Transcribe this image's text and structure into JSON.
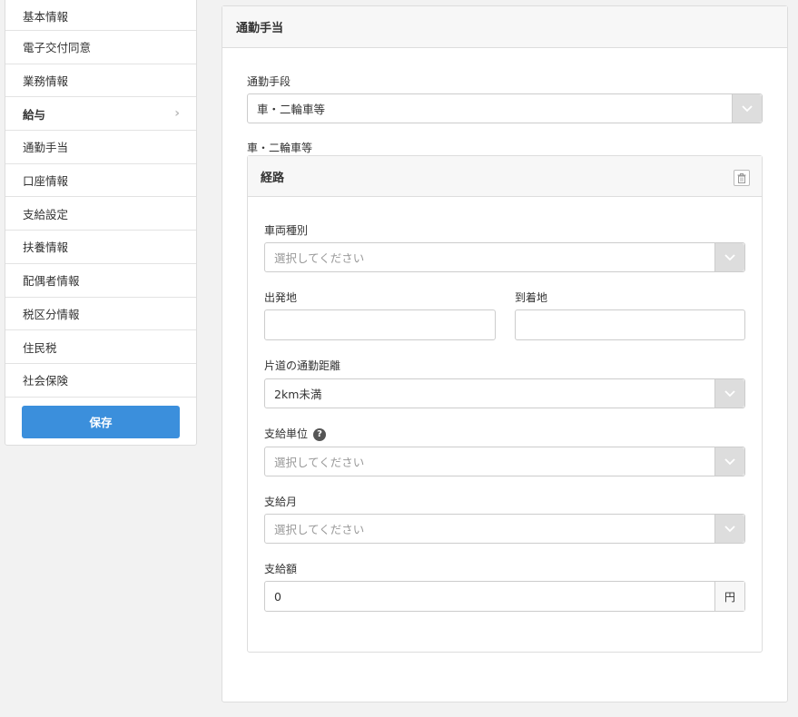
{
  "sidebar": {
    "items": [
      {
        "label": "基本情報"
      },
      {
        "label": "電子交付同意"
      },
      {
        "label": "業務情報"
      },
      {
        "label": "給与"
      },
      {
        "label": "通勤手当"
      },
      {
        "label": "口座情報"
      },
      {
        "label": "支給設定"
      },
      {
        "label": "扶養情報"
      },
      {
        "label": "配偶者情報"
      },
      {
        "label": "税区分情報"
      },
      {
        "label": "住民税"
      },
      {
        "label": "社会保険"
      }
    ],
    "save_label": "保存"
  },
  "card": {
    "title": "通勤手当",
    "commute_method_label": "通勤手段",
    "commute_method_value": "車・二輪車等",
    "section_label": "車・二輪車等",
    "route": {
      "title": "経路",
      "vehicle_type_label": "車両種別",
      "vehicle_type_placeholder": "選択してください",
      "departure_label": "出発地",
      "departure_value": "",
      "arrival_label": "到着地",
      "arrival_value": "",
      "distance_label": "片道の通勤距離",
      "distance_value": "2km未満",
      "pay_unit_label": "支給単位",
      "pay_unit_help": "?",
      "pay_unit_placeholder": "選択してください",
      "pay_month_label": "支給月",
      "pay_month_placeholder": "選択してください",
      "amount_label": "支給額",
      "amount_value": "0",
      "amount_unit": "円"
    }
  }
}
